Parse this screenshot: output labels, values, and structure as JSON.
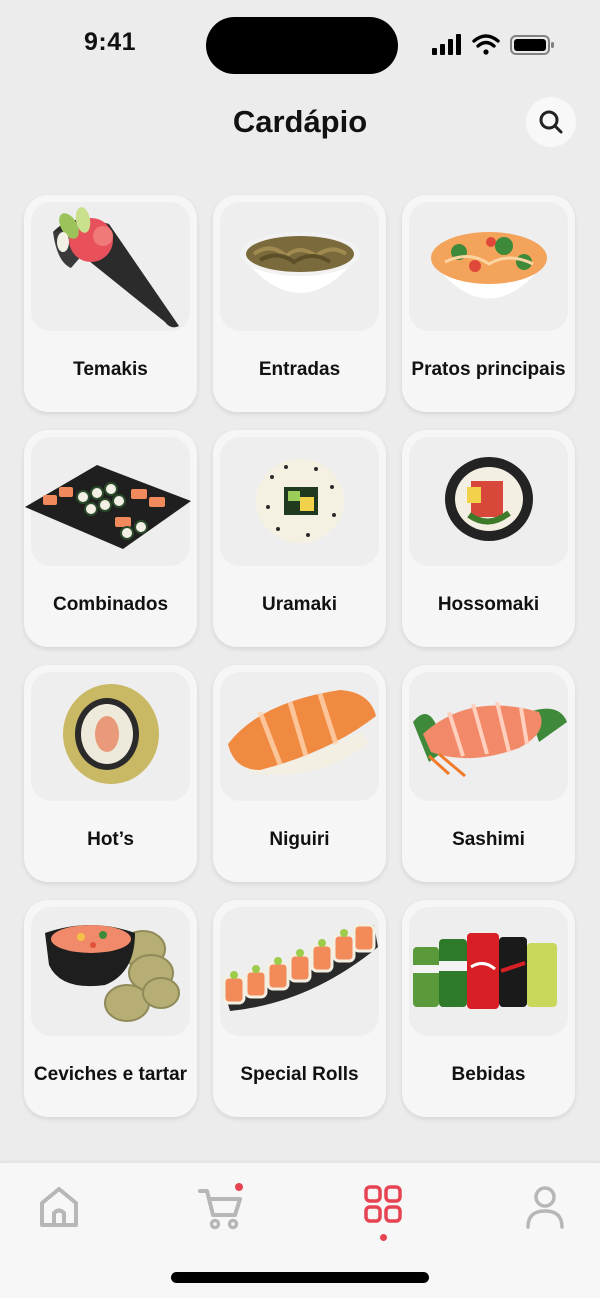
{
  "status_bar": {
    "time": "9:41"
  },
  "header": {
    "title": "Cardápio"
  },
  "categories": [
    {
      "label": "Temakis"
    },
    {
      "label": "Entradas"
    },
    {
      "label": "Pratos principais"
    },
    {
      "label": "Combinados"
    },
    {
      "label": "Uramaki"
    },
    {
      "label": "Hossomaki"
    },
    {
      "label": "Hot’s"
    },
    {
      "label": "Niguiri"
    },
    {
      "label": "Sashimi"
    },
    {
      "label": "Ceviches e tartar"
    },
    {
      "label": "Special Rolls"
    },
    {
      "label": "Bebidas"
    }
  ],
  "tab_bar": {
    "items": [
      {
        "icon": "home-icon"
      },
      {
        "icon": "cart-icon",
        "has_badge": true
      },
      {
        "icon": "grid-icon",
        "active": true
      },
      {
        "icon": "user-icon"
      }
    ]
  },
  "colors": {
    "accent": "#e64452",
    "inactive_icon": "#b7b7b7",
    "background": "#ececec",
    "card": "#f6f6f6"
  }
}
